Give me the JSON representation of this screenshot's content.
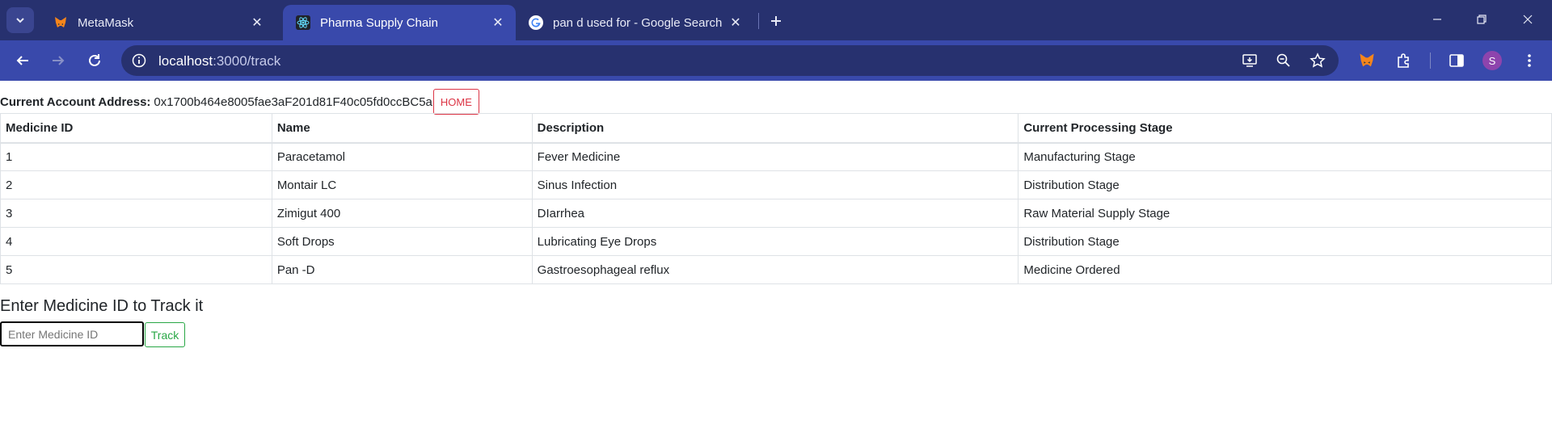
{
  "browser": {
    "tabs": [
      {
        "title": "MetaMask",
        "icon": "metamask-fox-icon",
        "active": false
      },
      {
        "title": "Pharma Supply Chain",
        "icon": "react-atom-icon",
        "active": true
      },
      {
        "title": "pan d used for - Google Search",
        "icon": "google-g-icon",
        "active": false
      }
    ],
    "url_host": "localhost",
    "url_path": ":3000/track",
    "profile_initial": "S",
    "accent": "#3949ab",
    "tabbar_bg": "#27316f"
  },
  "page": {
    "account_label": "Current Account Address:",
    "account_address": "0x1700b464e8005fae3aF201d81F40c05fd0ccBC5a",
    "home_button": "HOME",
    "table": {
      "headers": [
        "Medicine ID",
        "Name",
        "Description",
        "Current Processing Stage"
      ],
      "rows": [
        [
          "1",
          "Paracetamol",
          "Fever Medicine",
          "Manufacturing Stage"
        ],
        [
          "2",
          "Montair LC",
          "Sinus Infection",
          "Distribution Stage"
        ],
        [
          "3",
          "Zimigut 400",
          "DIarrhea",
          "Raw Material Supply Stage"
        ],
        [
          "4",
          "Soft Drops",
          "Lubricating Eye Drops",
          "Distribution Stage"
        ],
        [
          "5",
          "Pan -D",
          "Gastroesophageal reflux",
          "Medicine Ordered"
        ]
      ]
    },
    "track_heading": "Enter Medicine ID to Track it",
    "track_placeholder": "Enter Medicine ID",
    "track_value": "",
    "track_button": "Track",
    "colors": {
      "home": "#dc3545",
      "track": "#28a745"
    }
  }
}
